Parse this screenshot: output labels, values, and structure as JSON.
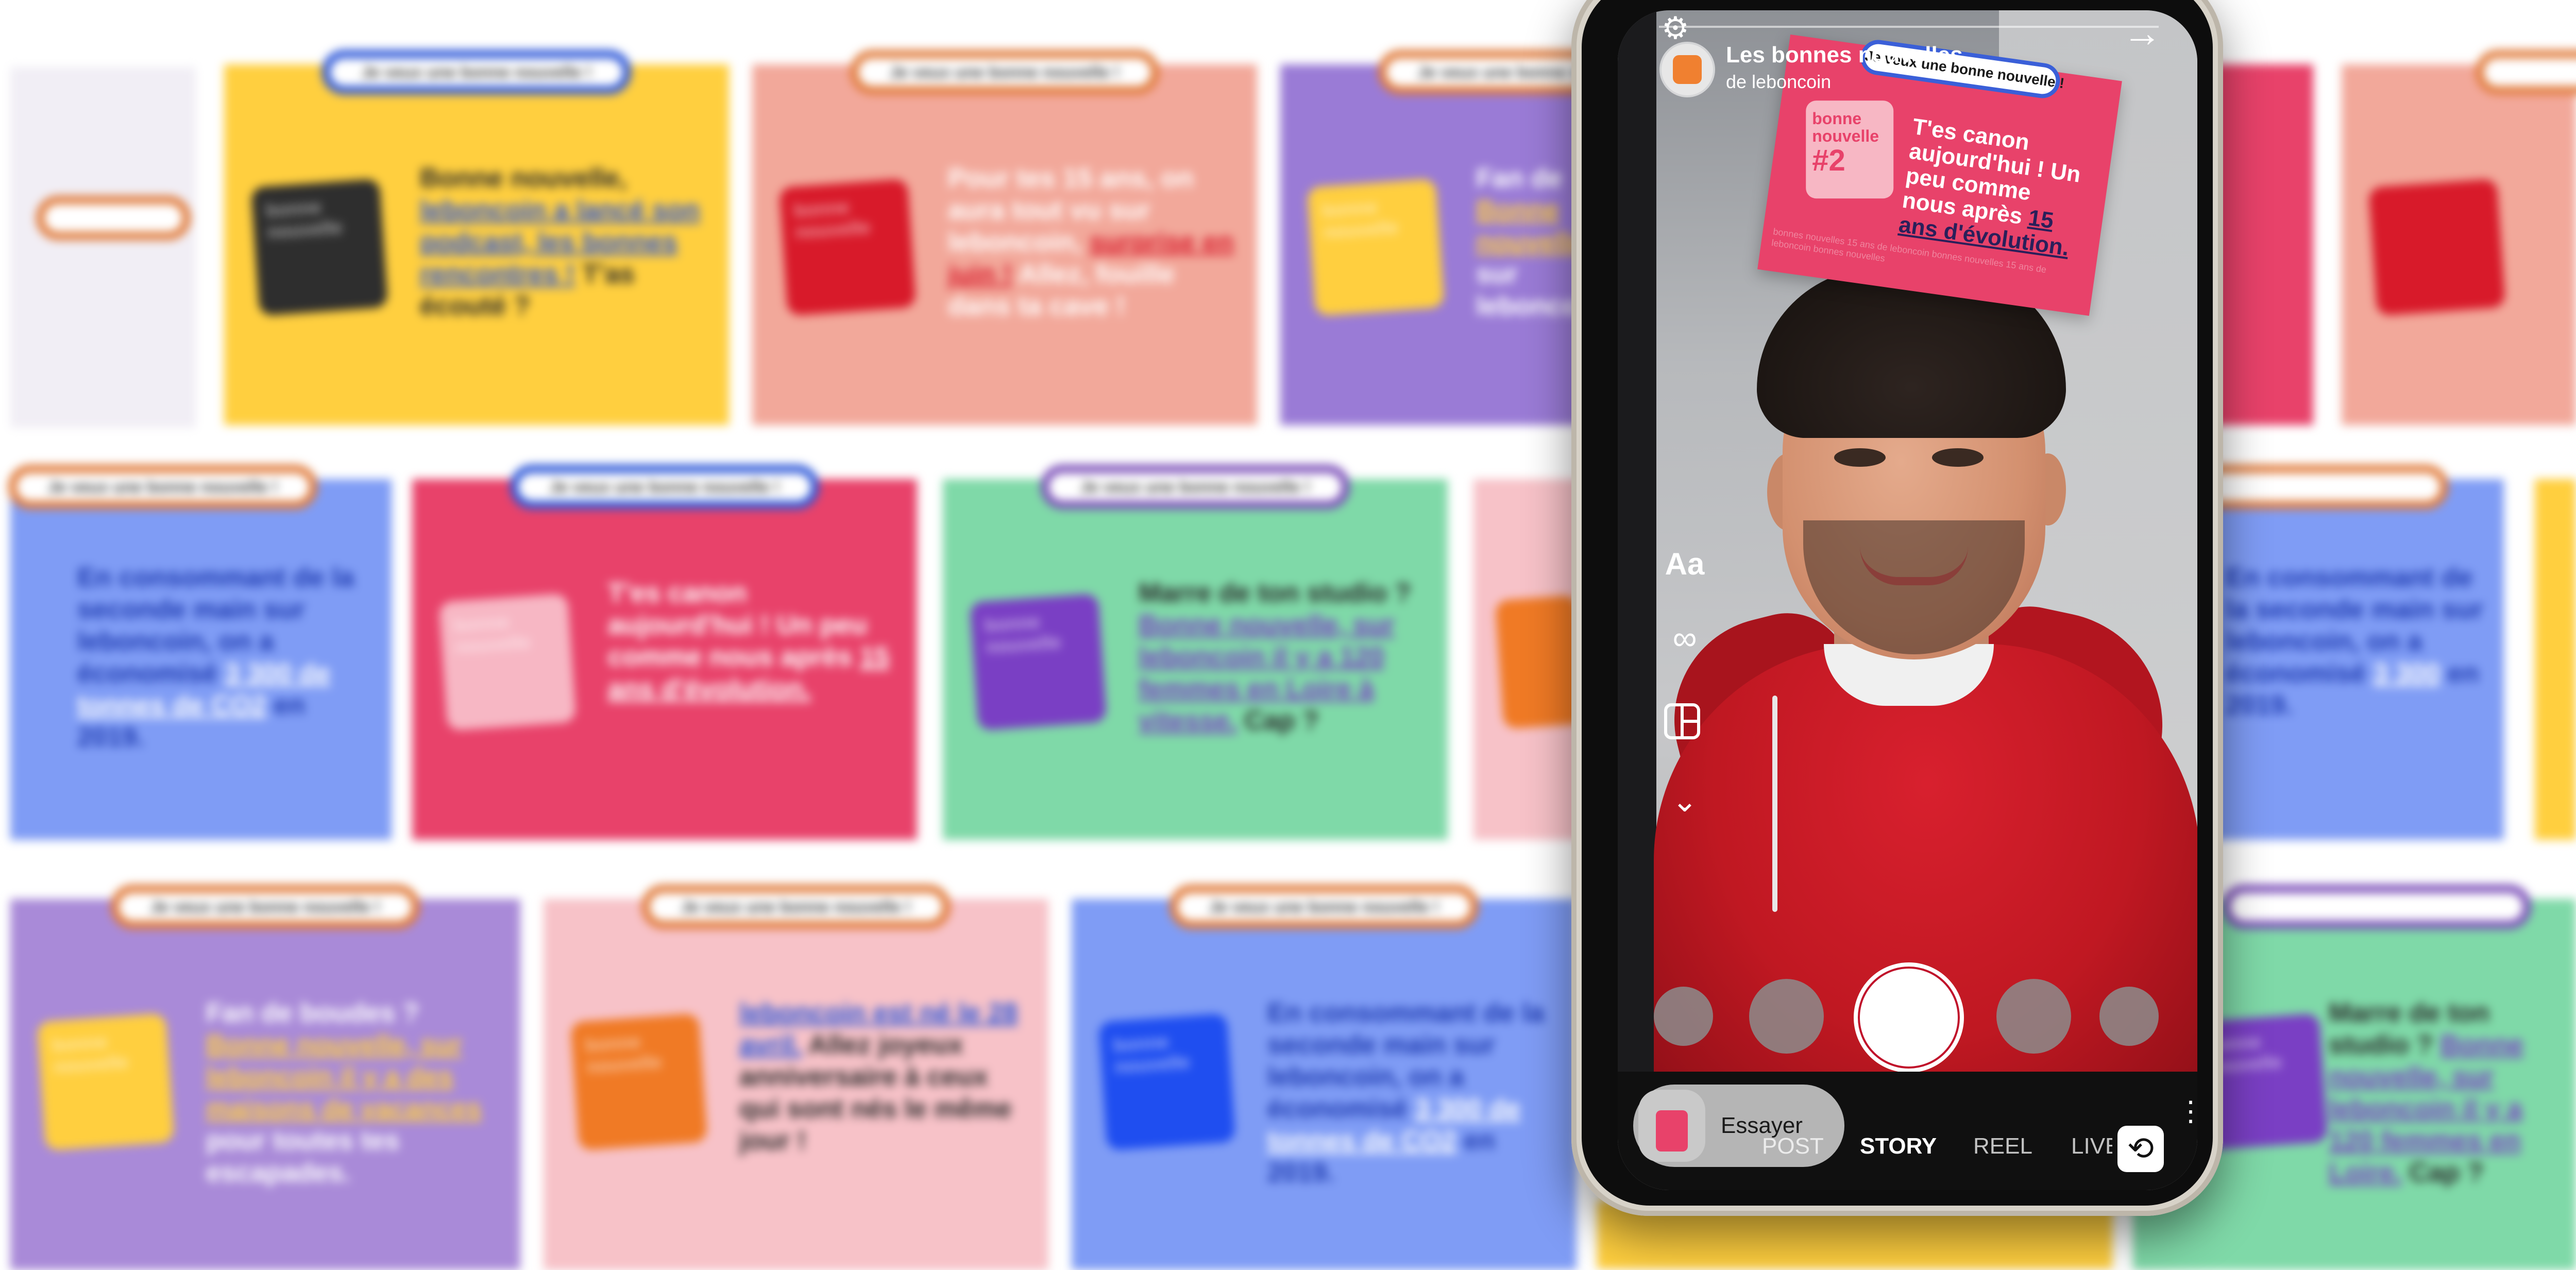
{
  "background_cards": [
    {
      "pill": "Je veux une bonne nouvelle !",
      "text_pre": "Bonne nouvelle, ",
      "text_hl": "leboncoin a lancé son podcast, les bonnes rencontres !",
      "text_post": " T'as écouté ?",
      "sticky": "bonne nouvelle"
    },
    {
      "pill": "Je veux une bonne nouvelle !",
      "text_pre": "Pour tes 15 ans, on aura tout vu sur leboncoin, ",
      "text_hl": "surprise en juin !",
      "text_post": " Allez, fouille dans ta cave !",
      "sticky": "bonne nouvelle"
    },
    {
      "pill": "Je veux une bonne nouvelle !",
      "text_pre": "Fan de ",
      "text_hl": "Bonne nouvelle",
      "text_post": " sur leboncoin",
      "sticky": "bonne nouvelle"
    },
    {
      "pill": "Je veux une bonne nouvelle !",
      "text_pre": "En consommant de la seconde main sur leboncoin, on a économisé ",
      "text_hl": "3 300 de tonnes de CO2",
      "text_post": " en 2019.",
      "sticky": ""
    },
    {
      "pill": "Je veux une bonne nouvelle !",
      "text_pre": "T'es canon aujourd'hui ! Un peu comme nous après ",
      "text_hl": "15 ans d'évolution.",
      "text_post": "",
      "sticky": "bonne nouvelle"
    },
    {
      "pill": "Je veux une bonne nouvelle !",
      "text_pre": "Marre de ton studio ? ",
      "text_hl": "Bonne nouvelle, sur leboncoin il y a 120 femmes en Loire à vitesse.",
      "text_post": " Cap ?",
      "sticky": "bonne nouvelle"
    },
    {
      "pill": "Je veux une bonne nouvelle !",
      "text_pre": "Fan de boudes ? ",
      "text_hl": "Bonne nouvelle, sur leboncoin il y a des maisons de vacances",
      "text_post": " pour toutes tes escapades.",
      "sticky": "bonne nouvelle"
    },
    {
      "pill": "Je veux une bonne nouvelle !",
      "text_pre": "",
      "text_hl": "leboncoin est né le 28 avril.",
      "text_post": " Allez joyeux anniversaire à ceux qui sont nés le même jour !",
      "sticky": "bonne nouvelle"
    },
    {
      "pill": "Je veux une bonne nouvelle !",
      "text_pre": "En consommant de la seconde main sur leboncoin, on a économisé ",
      "text_hl": "3 300 de tonnes de CO2",
      "text_post": " en 2019.",
      "sticky": "bonne nouvelle"
    },
    {
      "pill": "Je veux une bonne nouvelle !",
      "text_pre": "Marre de ton studio ? ",
      "text_hl": "Bonne nouvelle, sur leboncoin il y a 120 femmes en Loire.",
      "text_post": " Cap ?",
      "sticky": "bonne nouvelle"
    },
    {
      "pill": "Je veux une bonne nouvelle !",
      "text_pre": "En consommant de la seconde main sur leboncoin, on a économisé ",
      "text_hl": "3 300",
      "text_post": " en 2019.",
      "sticky": ""
    },
    {
      "pill": "Je veux une bonne nouvelle !",
      "text_pre": "",
      "text_hl": "",
      "text_post": "",
      "sticky": "bonne nouvelle"
    }
  ],
  "camera": {
    "effect_title": "Les bonnes nouvelles",
    "effect_creator": "de leboncoin",
    "ar_pill": "Je veux une bonne nouvelle !",
    "ar_note_line1": "bonne",
    "ar_note_line2": "nouvelle",
    "ar_note_number": "#2",
    "ar_text_pre": "T'es canon aujourd'hui ! Un peu comme nous après ",
    "ar_text_hl": "15 ans d'évolution.",
    "ar_footer": "bonnes nouvelles 15 ans de leboncoin bonnes nouvelles 15 ans de leboncoin bonnes nouvelles",
    "tools": {
      "text": "Aa",
      "boomerang": "∞",
      "more": "⌄"
    },
    "try_label": "Essayer",
    "modes": [
      "POST",
      "STORY",
      "REEL",
      "LIVE"
    ],
    "active_mode": "STORY"
  },
  "colors": {
    "yellow": "#ffcf3f",
    "salmon": "#f2a89a",
    "purple": "#9a7bd6",
    "blue": "#7f9cf5",
    "pink": "#e8426a",
    "green": "#7fd9a8",
    "lilac": "#a98ad8",
    "rose": "#f7c2c8",
    "instagram_shutter_ring": "#c0102a"
  }
}
